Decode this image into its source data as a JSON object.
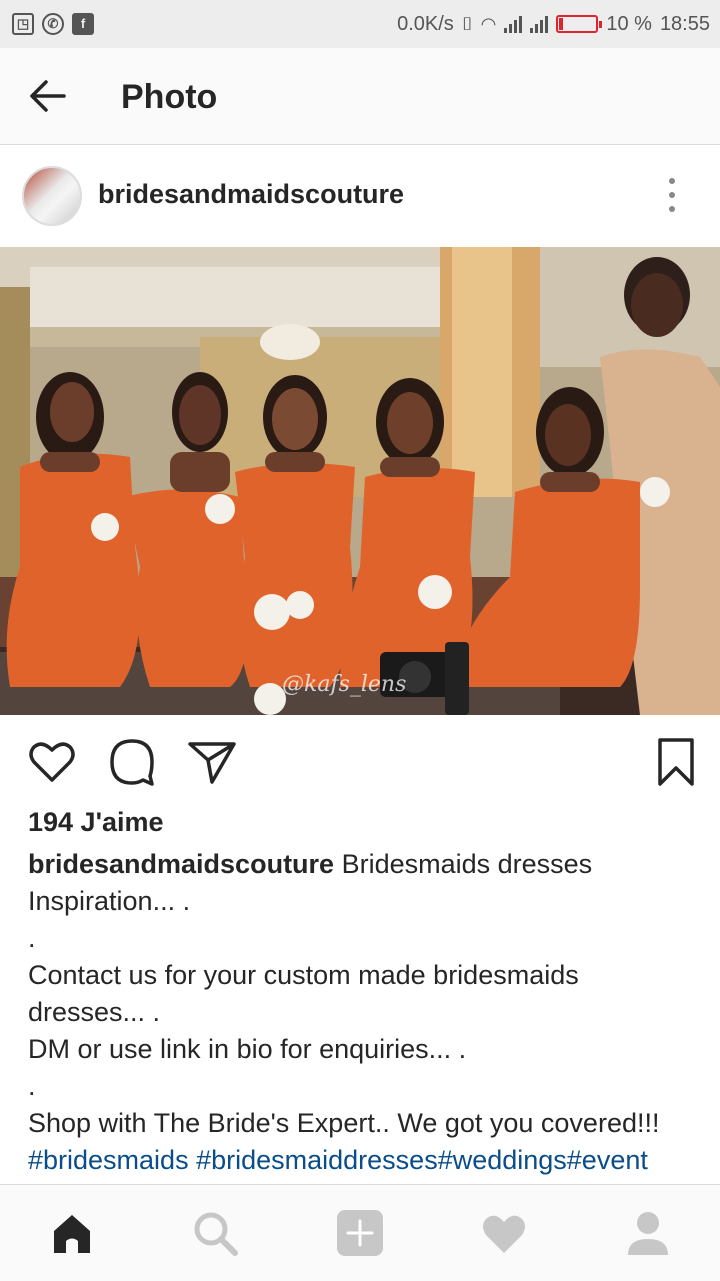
{
  "status_bar": {
    "left_icons": [
      "screen-cast-icon",
      "whatsapp-icon",
      "facebook-icon"
    ],
    "net_speed": "0.0K/s",
    "battery": "10 %",
    "battery_level": 0.1,
    "time": "18:55"
  },
  "topbar": {
    "title": "Photo"
  },
  "post": {
    "username": "bridesandmaidscouture",
    "likes": "194 J'aime",
    "watermark": "@kafs_lens",
    "caption": {
      "username": "bridesandmaidscouture",
      "line1_text": " Bridesmaids dresses",
      "line2": "Inspiration... .",
      "line3": ".",
      "line4": "Contact us for your custom made bridesmaids",
      "line5": "dresses... .",
      "line6": "DM or use link in bio for enquiries... .",
      "line7": ".",
      "line8": "Shop with The Bride's Expert.. We got you covered!!!",
      "hashtags": "#bridesmaids #bridesmaiddresses#weddings#event"
    }
  },
  "colors": {
    "link": "#0a4d8a",
    "text": "#262626",
    "battery_low": "#e0242f"
  }
}
